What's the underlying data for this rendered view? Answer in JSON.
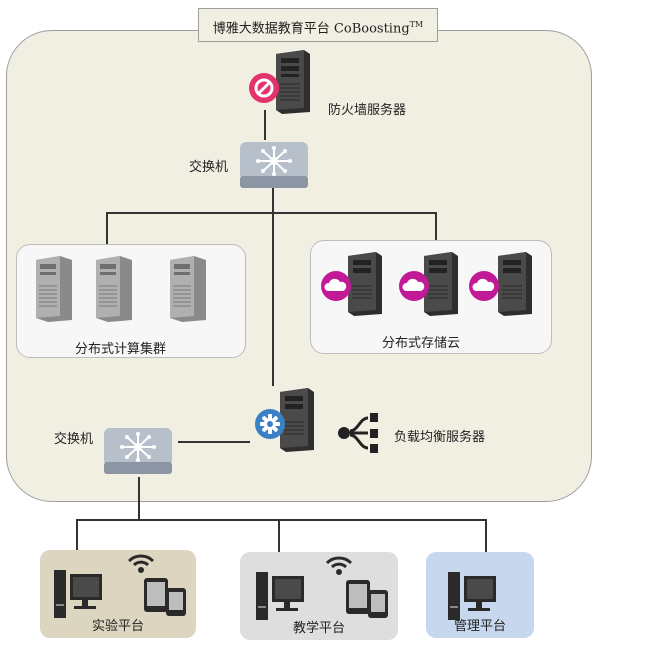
{
  "title": "博雅大数据教育平台 CoBoosting",
  "title_tm": "TM",
  "firewall_label": "防火墙服务器",
  "switch_top_label": "交换机",
  "switch_bottom_label": "交换机",
  "compute_cluster_label": "分布式计算集群",
  "storage_cloud_label": "分布式存储云",
  "load_balancer_label": "负载均衡服务器",
  "platforms": {
    "lab": "实验平台",
    "teaching": "教学平台",
    "management": "管理平台"
  },
  "colors": {
    "panel_bg": "#f1eee2",
    "firewall_badge": "#e2336b",
    "cloud_badge": "#c21a96",
    "gear_badge": "#3b7fc4",
    "lab_bg": "#dcd6c0",
    "teaching_bg": "#dedede",
    "management_bg": "#c6d7ee"
  }
}
